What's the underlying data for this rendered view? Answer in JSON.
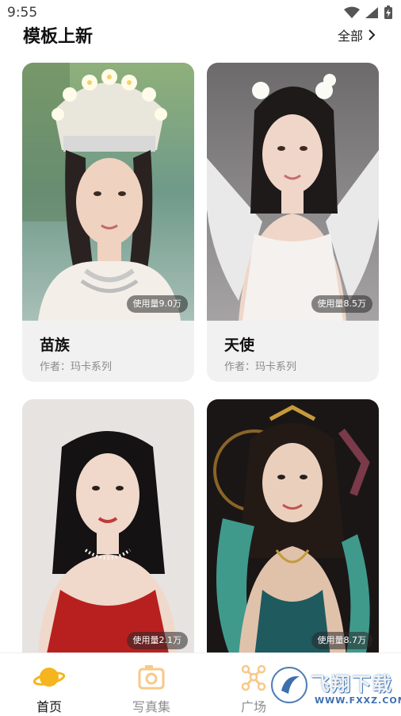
{
  "status_bar": {
    "time": "9:55"
  },
  "header": {
    "title": "模板上新",
    "all_label": "全部",
    "all_icon": "chevron-right-icon"
  },
  "cards": [
    {
      "title": "苗族",
      "author": "作者：玛卡系列",
      "usage": "使用量9.0万",
      "image": "portrait-miao-headdress"
    },
    {
      "title": "天使",
      "author": "作者：玛卡系列",
      "usage": "使用量8.5万",
      "image": "portrait-angel-wings"
    },
    {
      "title": "",
      "author": "",
      "usage": "使用量2.1万",
      "image": "portrait-red-dress"
    },
    {
      "title": "",
      "author": "",
      "usage": "使用量8.7万",
      "image": "portrait-fantasy-teal"
    }
  ],
  "tabs": [
    {
      "label": "首页",
      "icon": "planet-icon",
      "active": true
    },
    {
      "label": "写真集",
      "icon": "camera-icon",
      "active": false
    },
    {
      "label": "广场",
      "icon": "network-icon",
      "active": false
    }
  ],
  "watermark": {
    "text": "飞翔下载",
    "url": "WWW.FXXZ.COM"
  },
  "colors": {
    "accent": "#f5b51e",
    "accent_light": "#f7c98a",
    "card_bg": "#f1f1f1",
    "text_muted": "#8a8a8a"
  }
}
